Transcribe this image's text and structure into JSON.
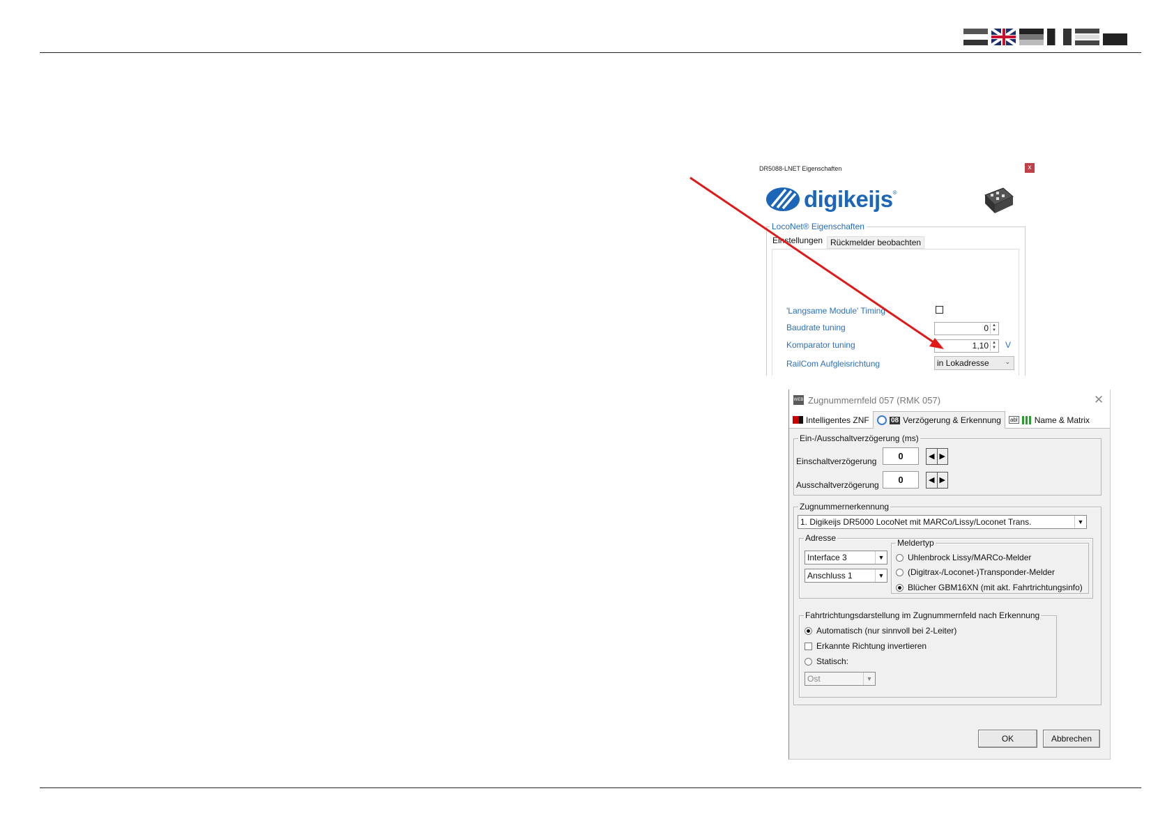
{
  "language_flags": [
    "flag-1",
    "flag-uk",
    "flag-de",
    "flag-it",
    "flag-nl",
    "flag-fr"
  ],
  "dr5088": {
    "window_title": "DR5088-LNET Eigenschaften",
    "close": "x",
    "logo_text": "digikeijs",
    "logo_reg": "®",
    "group_label": "LocoNet® Eigenschaften",
    "tabs": [
      "Einstellungen",
      "Rückmelder beobachten"
    ],
    "fields": {
      "slow_modules": "'Langsame Module' Timing",
      "baudrate": "Baudrate tuning",
      "baudrate_value": "0",
      "komparator": "Komparator tuning",
      "komparator_value": "1,10",
      "komparator_unit": "V",
      "railcom": "RailCom Aufgleisrichtung",
      "railcom_value": "in Lokadresse"
    }
  },
  "znf": {
    "title": "Zugnummernfeld 057 (RMK 057)",
    "app_icon": "WEB",
    "close": "✕",
    "tabs": [
      "Intelligentes ZNF",
      "Verzögerung & Erkennung",
      "Name & Matrix"
    ],
    "tab_icon_08": "08",
    "tab_icon_abl": "abl",
    "delay_group": "Ein-/Ausschaltverzögerung (ms)",
    "einschalt_label": "Einschaltverzögerung",
    "einschalt_value": "0",
    "ausschalt_label": "Ausschaltverzögerung",
    "ausschalt_value": "0",
    "recognition_group": "Zugnummernerkennung",
    "recognition_value": "1. Digikeijs DR5000 LocoNet mit MARCo/Lissy/Loconet Trans.",
    "address_group": "Adresse",
    "interface_value": "Interface 3",
    "anschluss_value": "Anschluss 1",
    "meldertyp_group": "Meldertyp",
    "meldertyp_options": [
      "Uhlenbrock Lissy/MARCo-Melder",
      "(Digitrax-/Loconet-)Transponder-Melder",
      "Blücher GBM16XN (mit akt. Fahrtrichtungsinfo)"
    ],
    "meldertyp_selected": 2,
    "direction_group": "Fahrtrichtungsdarstellung  im Zugnummernfeld nach Erkennung",
    "auto_label": "Automatisch (nur sinnvoll bei 2-Leiter)",
    "invert_label": "Erkannte Richtung invertieren",
    "static_label": "Statisch:",
    "static_value": "Ost",
    "ok_label": "OK",
    "cancel_label": "Abbrechen"
  },
  "colors": {
    "brand_blue": "#1b66b8",
    "label_blue": "#2a6fc0",
    "annotation_red": "#e01818"
  }
}
